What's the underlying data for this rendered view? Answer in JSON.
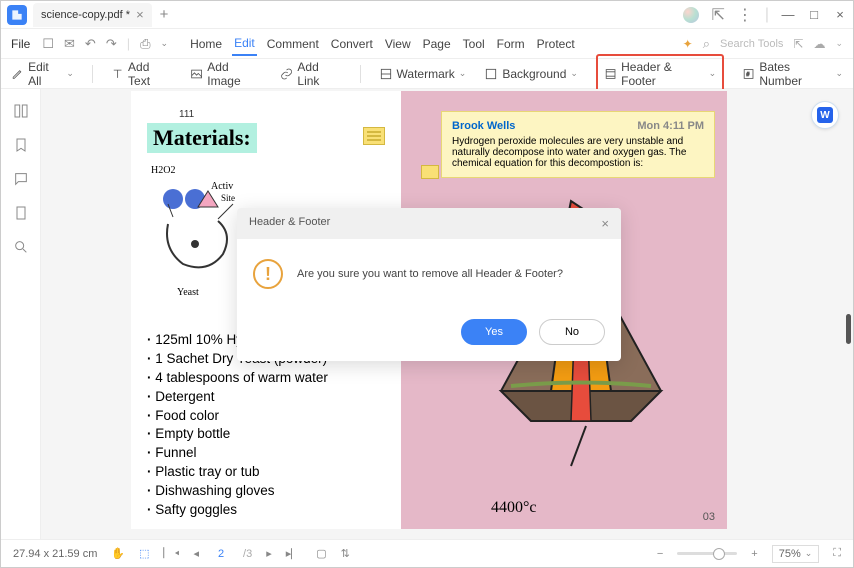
{
  "tab": {
    "title": "science-copy.pdf *"
  },
  "menu": {
    "file": "File",
    "items": [
      "Home",
      "Edit",
      "Comment",
      "Convert",
      "View",
      "Page",
      "Tool",
      "Form",
      "Protect"
    ],
    "active": 1,
    "search": "Search Tools"
  },
  "toolbar": {
    "editAll": "Edit All",
    "addText": "Add Text",
    "addImage": "Add Image",
    "addLink": "Add Link",
    "watermark": "Watermark",
    "background": "Background",
    "headerFooter": "Header & Footer",
    "bates": "Bates Number"
  },
  "doc": {
    "pageNum1": "111",
    "title": "Materials:",
    "h2o2": "H2O2",
    "active": "Activ",
    "site": "Site",
    "yeast": "Yeast",
    "list": [
      "125ml 10% Hydrogen Peroxide",
      "1 Sachet Dry Yeast (powder)",
      "4 tablespoons of warm water",
      "Detergent",
      "Food color",
      "Empty bottle",
      "Funnel",
      "Plastic tray or tub",
      "Dishwashing gloves",
      "Safty goggles"
    ],
    "comment": {
      "author": "Brook Wells",
      "time": "Mon 4:11 PM",
      "text": "Hydrogen peroxide molecules are very unstable and naturally decompose into water and oxygen gas. The chemical equation for this decompostion is:"
    },
    "temp": "4400°c",
    "pageNum2": "03"
  },
  "dialog": {
    "title": "Header & Footer",
    "text": "Are you sure you want to remove all Header & Footer?",
    "yes": "Yes",
    "no": "No"
  },
  "status": {
    "dims": "27.94 x 21.59 cm",
    "page": "2",
    "total": "/3",
    "zoom": "75%"
  }
}
